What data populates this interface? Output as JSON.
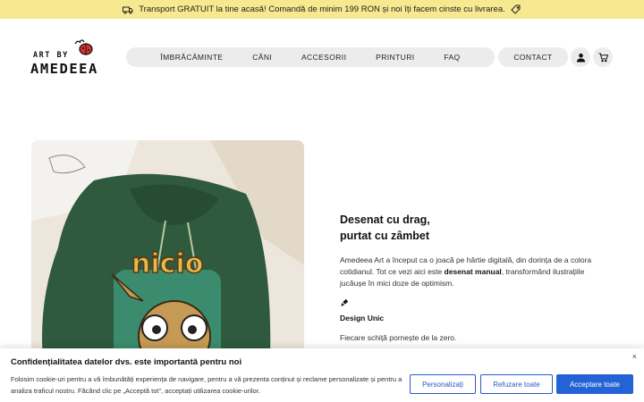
{
  "promo": {
    "text": "Transport GRATUIT la tine acasă! Comandă de minim 199 RON și noi îți facem cinste cu livrarea."
  },
  "logo": {
    "top_text": "ART BY",
    "main_text": "AMEDEEA"
  },
  "nav": {
    "items": [
      "ÎMBRĂCĂMINTE",
      "CĂNI",
      "ACCESORII",
      "PRINTURI",
      "FAQ"
    ],
    "contact": "CONTACT"
  },
  "hero": {
    "image_text": "nicio"
  },
  "about": {
    "heading_line1": "Desenat cu drag,",
    "heading_line2": "purtat cu zâmbet",
    "desc_part1": "Amedeea Art a început ca o joacă pe hârtie digitală, din dorința de a colora cotidianul. Tot ce vezi aici este ",
    "desc_bold": "desenat manual",
    "desc_part2": ", transformând ilustrațiile jucăușe în mici doze de optimism.",
    "feature_title": "Design Unic",
    "feature_text": "Fiecare schiță pornește de la zero."
  },
  "cookie": {
    "title": "Confidențialitatea datelor dvs. este importantă pentru noi",
    "text": "Folosim cookie-uri pentru a vă îmbunătăți experiența de navigare, pentru a vă prezenta conținut și reclame personalizate și pentru a analiza traficul nostru. Făcând clic pe „Acceptă tot”, acceptați utilizarea cookie-urilor.",
    "customize": "Personalizați",
    "reject": "Refuzare toate",
    "accept": "Acceptare toate",
    "close": "×"
  },
  "colors": {
    "promo_bg": "#f6e98f",
    "nav_bg": "#ececec",
    "accent_blue": "#2463d6",
    "hoodie": "#2f5a3e"
  }
}
